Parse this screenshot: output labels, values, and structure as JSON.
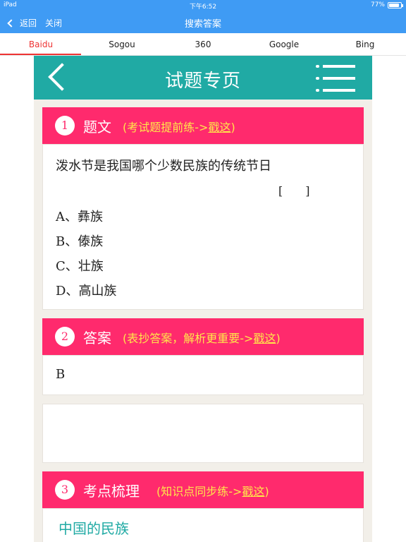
{
  "status_bar": {
    "device": "iPad",
    "time": "下午6:52",
    "battery": "77%"
  },
  "nav": {
    "back_label": "返回",
    "close_label": "关闭",
    "title": "搜索答案"
  },
  "tabs": [
    {
      "label": "Baidu",
      "active": true
    },
    {
      "label": "Sogou",
      "active": false
    },
    {
      "label": "360",
      "active": false
    },
    {
      "label": "Google",
      "active": false
    },
    {
      "label": "Bing",
      "active": false
    }
  ],
  "page": {
    "header_title": "试题专页",
    "sections": {
      "question": {
        "number": "1",
        "title": "题文",
        "hint_prefix": "(考试题提前练->",
        "hint_link": "戳这",
        "hint_suffix": ")",
        "text": "泼水节是我国哪个少数民族的传统节日",
        "bracket": "[　　]",
        "options": [
          {
            "letter": "A、",
            "text": "彝族"
          },
          {
            "letter": "B、",
            "text": "傣族"
          },
          {
            "letter": "C、",
            "text": "壮族"
          },
          {
            "letter": "D、",
            "text": "高山族"
          }
        ]
      },
      "answer": {
        "number": "2",
        "title": "答案",
        "hint_prefix": "(表抄答案，解析更重要->",
        "hint_link": "戳这",
        "hint_suffix": ")",
        "value": "B"
      },
      "topics": {
        "number": "3",
        "title": "考点梳理",
        "hint_prefix": "(知识点同步练->",
        "hint_link": "戳这",
        "hint_suffix": ")",
        "items": [
          "中国的民族"
        ]
      }
    }
  },
  "colors": {
    "nav_blue": "#3f9bf4",
    "header_teal": "#20aaa4",
    "section_pink": "#ff2a6d",
    "hint_yellow": "#ffe74a",
    "tab_active": "#ee3333"
  }
}
